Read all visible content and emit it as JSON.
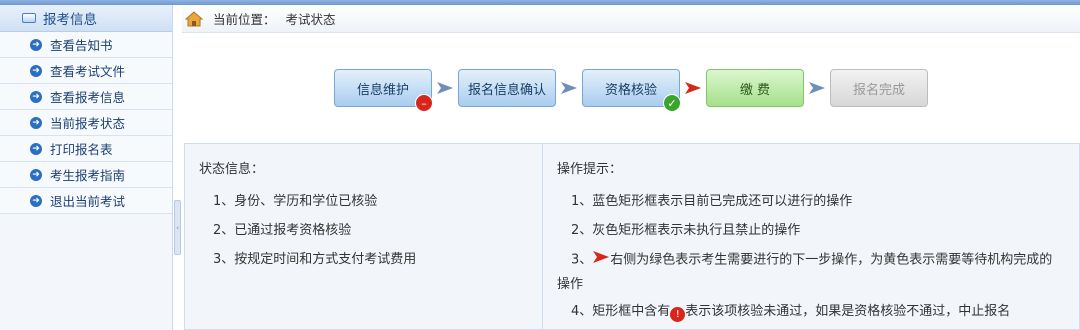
{
  "sidebar": {
    "header": "报考信息",
    "items": [
      {
        "label": "查看告知书"
      },
      {
        "label": "查看考试文件"
      },
      {
        "label": "查看报考信息"
      },
      {
        "label": "当前报考状态"
      },
      {
        "label": "打印报名表"
      },
      {
        "label": "考生报考指南"
      },
      {
        "label": "退出当前考试"
      }
    ]
  },
  "breadcrumb": {
    "prefix": "当前位置：",
    "current": "考试状态"
  },
  "steps": [
    {
      "label": "信息维护",
      "state": "blue",
      "badge": "fail"
    },
    {
      "label": "报名信息确认",
      "state": "blue",
      "badge": ""
    },
    {
      "label": "资格核验",
      "state": "blue",
      "badge": "pass"
    },
    {
      "label": "缴 费",
      "state": "green",
      "badge": ""
    },
    {
      "label": "报名完成",
      "state": "grey",
      "badge": ""
    }
  ],
  "status": {
    "title": "状态信息：",
    "lines": [
      "1、身份、学历和学位已核验",
      "2、已通过报考资格核验",
      "3、按规定时间和方式支付考试费用"
    ]
  },
  "tips": {
    "title": "操作提示：",
    "line1": "1、蓝色矩形框表示目前已完成还可以进行的操作",
    "line2": "2、灰色矩形框表示未执行且禁止的操作",
    "line3_prefix": "3、",
    "line3_text": "右侧为绿色表示考生需要进行的下一步操作，为黄色表示需要等待机构完成的",
    "line3_cont": "操作",
    "line4_prefix": "4、矩形框中含有",
    "line4_text": "表示该项核验未通过，如果是资格核验不通过，中止报名"
  },
  "colors": {
    "step_blue": "#a9cdef",
    "step_green": "#a5e08b",
    "step_grey": "#d7d7d7",
    "fail_badge": "#d9261c",
    "pass_badge": "#3aa52b",
    "next_arrow": "#d9261c",
    "done_arrow": "#6f8fb5"
  },
  "icons": {
    "home": "home-icon",
    "sidebar_bullet": "circle-arrow-right-icon",
    "fail": "exclamation-circle-icon",
    "pass": "check-circle-icon"
  }
}
